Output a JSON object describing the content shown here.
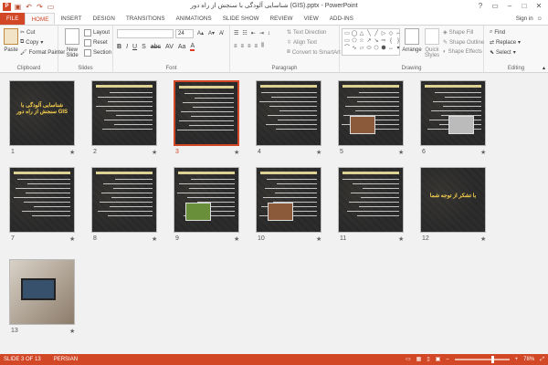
{
  "window": {
    "title": "شناسایی آلودگی با سنجش از راه دور (GIS).pptx - PowerPoint"
  },
  "signin": {
    "label": "Sign in"
  },
  "tabs": [
    "FILE",
    "HOME",
    "INSERT",
    "DESIGN",
    "TRANSITIONS",
    "ANIMATIONS",
    "SLIDE SHOW",
    "REVIEW",
    "VIEW",
    "ADD-INS"
  ],
  "ribbon": {
    "clipboard": {
      "label": "Clipboard",
      "paste": "Paste",
      "cut": "Cut",
      "copy": "Copy",
      "format_painter": "Format Painter"
    },
    "slides": {
      "label": "Slides",
      "new_slide": "New Slide",
      "layout": "Layout",
      "reset": "Reset",
      "section": "Section"
    },
    "font": {
      "label": "Font",
      "size": "24"
    },
    "paragraph": {
      "label": "Paragraph",
      "text_direction": "Text Direction",
      "align_text": "Align Text",
      "convert": "Convert to SmartArt"
    },
    "drawing": {
      "label": "Drawing",
      "arrange": "Arrange",
      "quick_styles": "Quick Styles",
      "shape_fill": "Shape Fill",
      "shape_outline": "Shape Outline",
      "shape_effects": "Shape Effects"
    },
    "editing": {
      "label": "Editing",
      "find": "Find",
      "replace": "Replace",
      "select": "Select"
    }
  },
  "slides": [
    {
      "n": "1",
      "title": "شناسایی آلودگی با سنجش از راه دور GIS"
    },
    {
      "n": "2",
      "title": ""
    },
    {
      "n": "3",
      "title": ""
    },
    {
      "n": "4",
      "title": ""
    },
    {
      "n": "5",
      "title": ""
    },
    {
      "n": "6",
      "title": ""
    },
    {
      "n": "7",
      "title": ""
    },
    {
      "n": "8",
      "title": ""
    },
    {
      "n": "9",
      "title": ""
    },
    {
      "n": "10",
      "title": ""
    },
    {
      "n": "11",
      "title": ""
    },
    {
      "n": "12",
      "title": "با تشکر از توجه شما"
    },
    {
      "n": "13",
      "title": ""
    }
  ],
  "selected_slide": "3",
  "status": {
    "slide": "SLIDE 3 OF 13",
    "language": "PERSIAN",
    "zoom": "78%"
  }
}
